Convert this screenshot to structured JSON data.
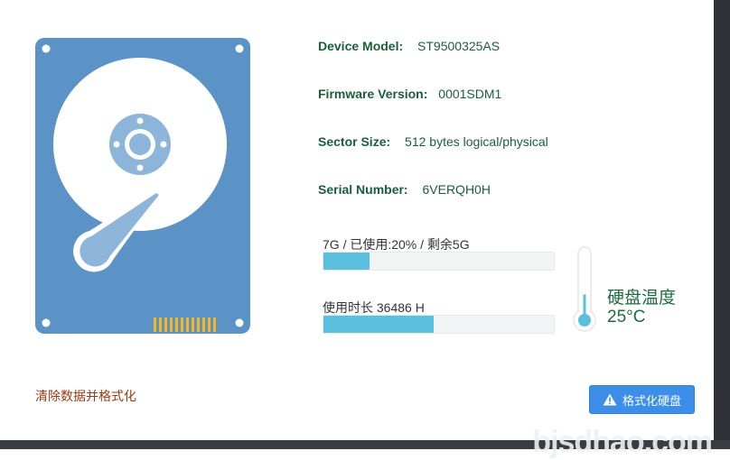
{
  "disk": {
    "device_model_label": "Device Model:",
    "device_model": "ST9500325AS",
    "firmware_label": "Firmware Version:",
    "firmware": "0001SDM1",
    "sector_label": "Sector Size:",
    "sector": "512 bytes logical/physical",
    "serial_label": "Serial Number:",
    "serial": "6VERQH0H"
  },
  "usage": {
    "label": "7G / 已使用:20% / 剩余5G",
    "fraction": 0.2
  },
  "hours": {
    "label": "使用时长 36486 H",
    "fraction": 0.48
  },
  "temperature": {
    "label": "硬盘温度",
    "value": "25°C",
    "level": 0.35
  },
  "actions": {
    "clear_link": "清除数据并格式化",
    "format_button": "格式化硬盘"
  },
  "icons": {
    "hdd": "hard-drive-icon",
    "thermometer": "thermometer-icon",
    "warning": "warning-icon"
  },
  "colors": {
    "hdd_body": "#5b93c7",
    "progress": "#5bc0de",
    "text_green": "#1b5e3a",
    "link_red": "#9a3a12",
    "button_blue": "#3c8ee8"
  },
  "watermark": "bjsdhao.com"
}
